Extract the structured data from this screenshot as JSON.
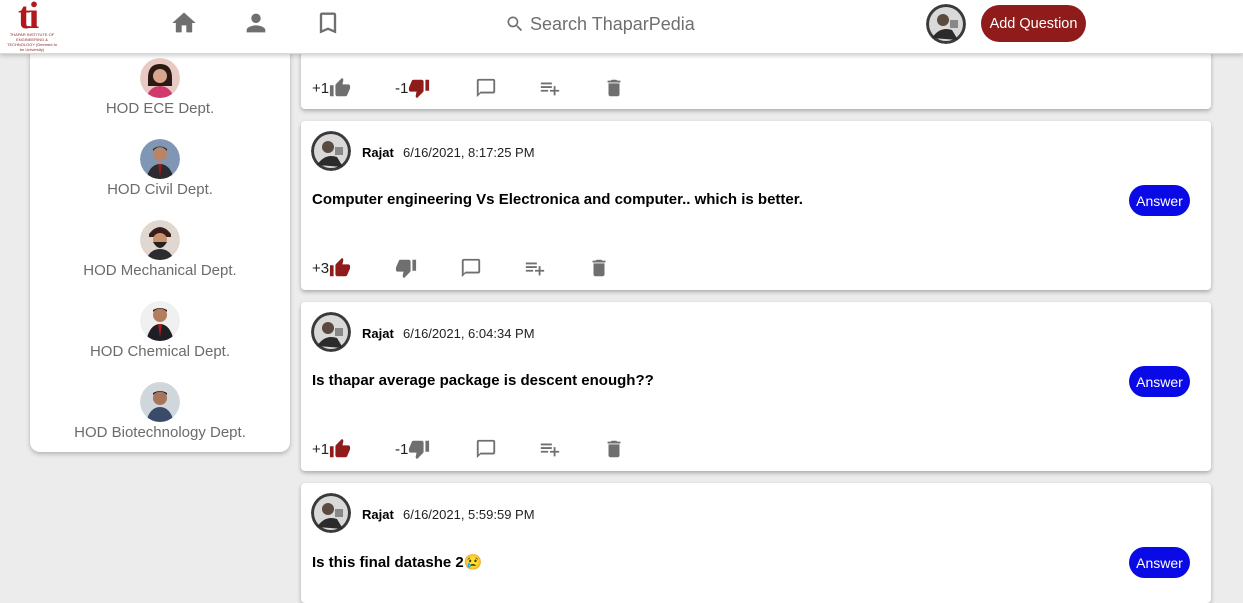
{
  "header": {
    "logo_text": "ti",
    "logo_subtext": "THAPAR INSTITUTE OF ENGINEERING & TECHNOLOGY (Deemed to be University)",
    "search_placeholder": "Search ThaparPedia",
    "add_question_label": "Add Question",
    "icons": [
      "home-icon",
      "person-icon",
      "bookmark-icon",
      "search-icon"
    ]
  },
  "sidebar": {
    "items": [
      {
        "label": "HOD ECE Dept."
      },
      {
        "label": "HOD Civil Dept."
      },
      {
        "label": "HOD Mechanical Dept."
      },
      {
        "label": "HOD Chemical Dept."
      },
      {
        "label": "HOD Biotechnology Dept."
      }
    ]
  },
  "posts": [
    {
      "user": "",
      "time": "",
      "question": "",
      "upvotes": "+1",
      "downvotes": "-1",
      "liked": false,
      "disliked": true
    },
    {
      "user": "Rajat",
      "time": "6/16/2021, 8:17:25 PM",
      "question": "Computer engineering Vs Electronica and computer.. which is better.",
      "answer_label": "Answer",
      "upvotes": "+3",
      "downvotes": "",
      "liked": true,
      "disliked": false
    },
    {
      "user": "Rajat",
      "time": "6/16/2021, 6:04:34 PM",
      "question": "Is thapar average package is descent enough??",
      "answer_label": "Answer",
      "upvotes": "+1",
      "downvotes": "-1",
      "liked": true,
      "disliked": false
    },
    {
      "user": "Rajat",
      "time": "6/16/2021, 5:59:59 PM",
      "question": "Is this final datashe 2😢",
      "answer_label": "Answer"
    }
  ],
  "colors": {
    "brand_red": "#8f1b1b",
    "answer_blue": "#0a0ae6",
    "icon_gray": "#6f6f6f",
    "liked_red": "#8f1b1b"
  }
}
